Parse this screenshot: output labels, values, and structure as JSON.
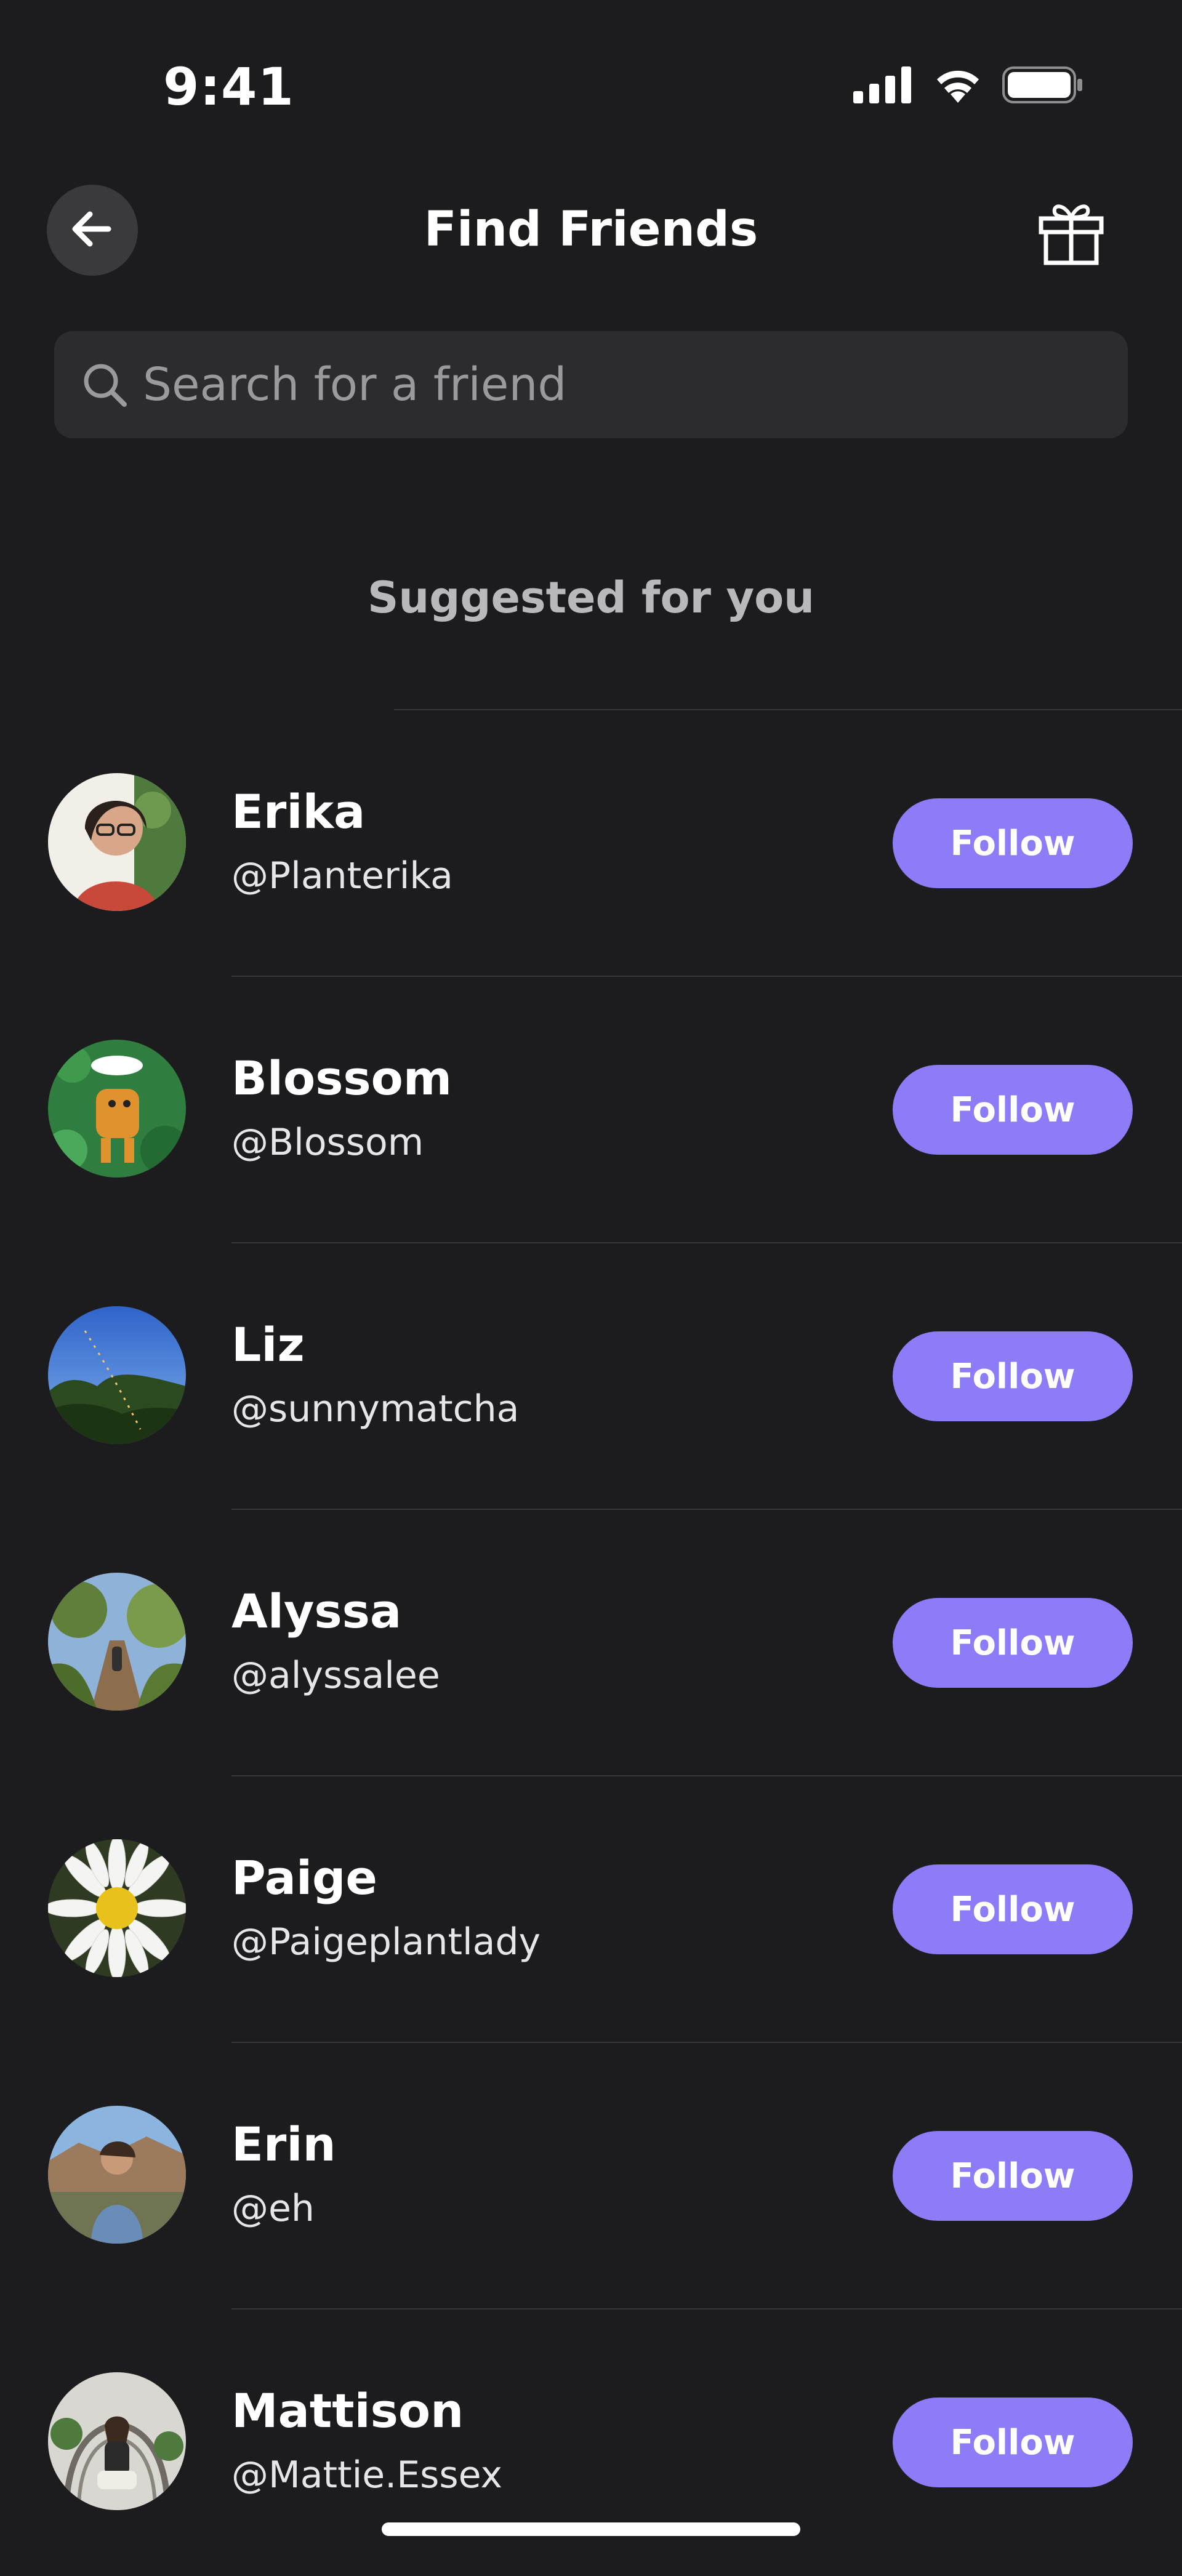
{
  "status_bar": {
    "time": "9:41"
  },
  "header": {
    "title": "Find Friends"
  },
  "search": {
    "placeholder": "Search for a friend",
    "value": ""
  },
  "section": {
    "title": "Suggested for you"
  },
  "colors": {
    "background": "#1c1c1e",
    "accent": "#8c7cf7",
    "search_bg": "#2c2c2e"
  },
  "icons": {
    "back": "arrow-left-icon",
    "gift": "gift-icon",
    "search": "search-icon"
  },
  "friends": [
    {
      "name": "Erika",
      "handle": "@Planterika",
      "button": "Follow"
    },
    {
      "name": "Blossom",
      "handle": "@Blossom",
      "button": "Follow"
    },
    {
      "name": "Liz",
      "handle": "@sunnymatcha",
      "button": "Follow"
    },
    {
      "name": "Alyssa",
      "handle": "@alyssalee",
      "button": "Follow"
    },
    {
      "name": "Paige",
      "handle": "@Paigeplantlady",
      "button": "Follow"
    },
    {
      "name": "Erin",
      "handle": "@eh",
      "button": "Follow"
    },
    {
      "name": "Mattison",
      "handle": "@Mattie.Essex",
      "button": "Follow"
    }
  ]
}
